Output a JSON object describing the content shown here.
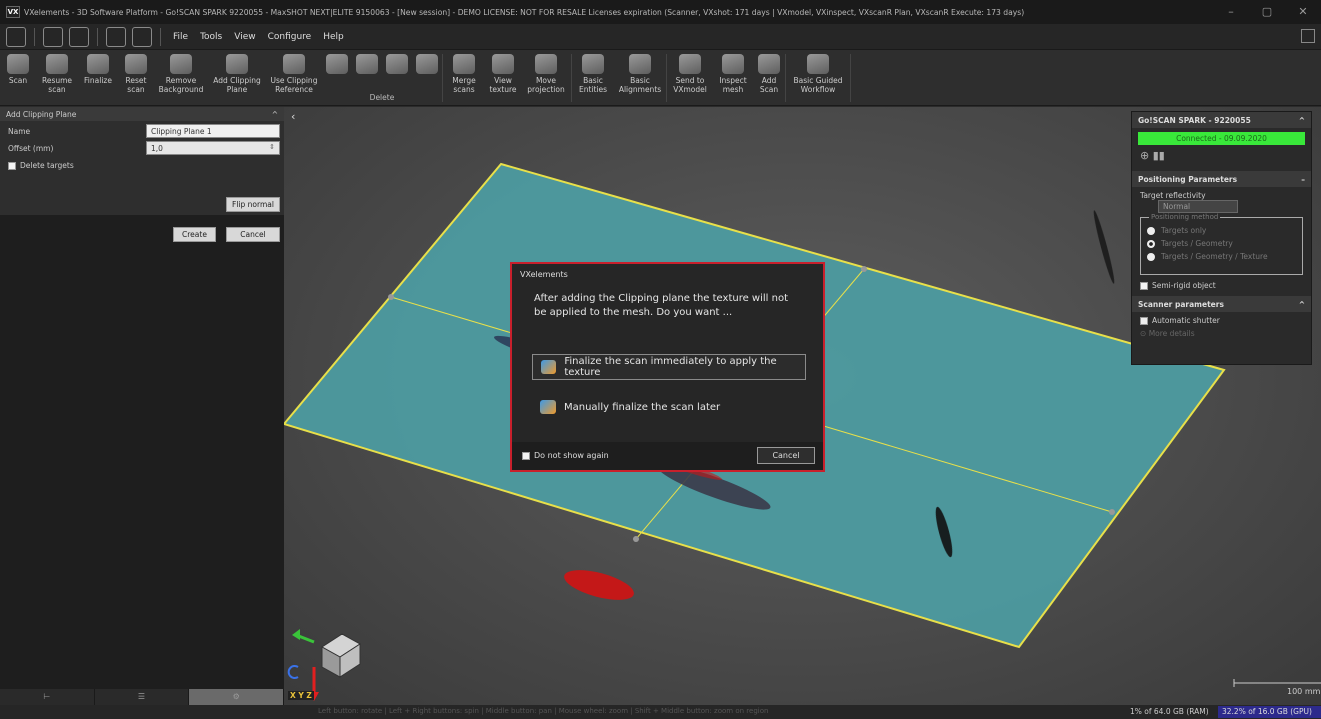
{
  "titlebar": {
    "logo": "VX",
    "title": "VXelements - 3D Software Platform - Go!SCAN SPARK 9220055 - MaxSHOT NEXT|ELITE 9150063 - [New session] - DEMO LICENSE: NOT FOR RESALE Licenses expiration (Scanner, VXshot: 171 days | VXmodel, VXinspect, VXscanR Plan, VXscanR Execute: 173 days)",
    "minimize": "–",
    "maximize": "▢",
    "close": "✕"
  },
  "menu": [
    "File",
    "Tools",
    "View",
    "Configure",
    "Help"
  ],
  "ribbon": {
    "buttons": [
      {
        "label": "Scan",
        "dropdown": true
      },
      {
        "label": "Resume\nscan"
      },
      {
        "label": "Finalize",
        "dropdown": true
      },
      {
        "label": "Reset\nscan"
      },
      {
        "label": "Remove\nBackground"
      },
      {
        "label": "Add Clipping\nPlane"
      },
      {
        "label": "Use Clipping\nReference"
      }
    ],
    "delete_group_label": "Delete",
    "buttons2": [
      {
        "label": "Merge\nscans"
      },
      {
        "label": "View\ntexture"
      },
      {
        "label": "Move\nprojection"
      },
      {
        "label": "Basic\nEntities"
      },
      {
        "label": "Basic\nAlignments"
      },
      {
        "label": "Send to\nVXmodel"
      },
      {
        "label": "Inspect\nmesh"
      },
      {
        "label": "Add\nScan"
      },
      {
        "label": "Basic Guided\nWorkflow"
      }
    ]
  },
  "leftpanel": {
    "header": "Add Clipping Plane",
    "collapse": "^",
    "name_label": "Name",
    "name_value": "Clipping Plane 1",
    "offset_label": "Offset (mm)",
    "offset_value": "1,0",
    "delete_targets_label": "Delete targets",
    "flip_normal": "Flip normal",
    "create": "Create",
    "cancel": "Cancel",
    "footer_icons": [
      "⊢",
      "☰",
      "⚙"
    ]
  },
  "rightpanel": {
    "scanner_title": "Go!SCAN SPARK - 9220055",
    "connected": "Connected - 09.09.2020",
    "positioning_title": "Positioning Parameters",
    "target_reflectivity_label": "Target reflectivity",
    "target_reflectivity_value": "Normal",
    "positioning_method": "Positioning method",
    "options": [
      "Targets only",
      "Targets / Geometry",
      "Targets / Geometry / Texture"
    ],
    "semi_rigid": "Semi-rigid object",
    "scanner_params_title": "Scanner parameters",
    "auto_shutter": "Automatic shutter",
    "more_details": "More details"
  },
  "dialog": {
    "title": "VXelements",
    "message": "After adding the Clipping plane the texture will not be applied to the mesh. Do you want ...",
    "option1": "Finalize the scan immediately to apply the texture",
    "option2": "Manually finalize the scan later",
    "do_not_show": "Do not show again",
    "cancel": "Cancel"
  },
  "viewport": {
    "scale_label": "100 mm",
    "axes_label": "X Y Z"
  },
  "status": {
    "hint": "Left button: rotate | Left + Right buttons: spin | Middle button: pan | Mouse wheel: zoom | Shift + Middle button: zoom on region",
    "ram": "1% of 64.0 GB (RAM)",
    "gpu": "32.2% of 16.0 GB (GPU)"
  },
  "colors": {
    "plane": "#4d9ba0",
    "plane_edge": "#e8e04a",
    "connected": "#39e83a",
    "dialog_border": "#c8202c"
  }
}
